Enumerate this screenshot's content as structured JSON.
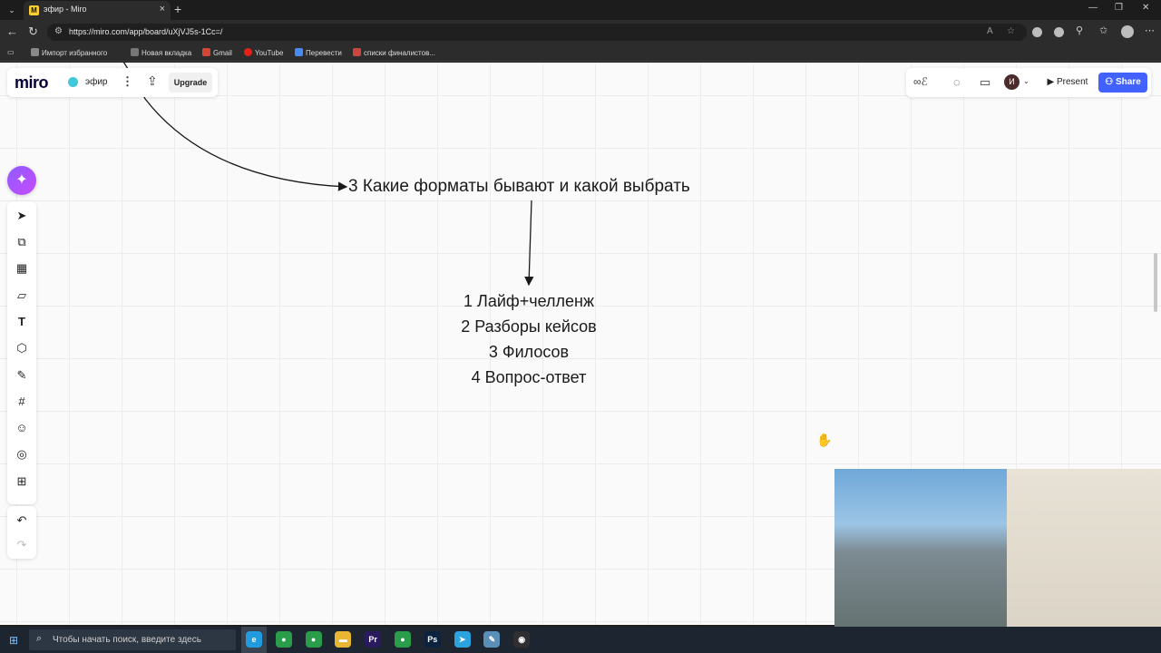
{
  "browser": {
    "tab_title": "эфир - Miro",
    "url": "https://miro.com/app/board/uXjVJ5s-1Cc=/",
    "bookmarks": [
      "Импорт избранного",
      "Новая вкладка",
      "Gmail",
      "YouTube",
      "Перевести",
      "списки финалистов..."
    ]
  },
  "miro": {
    "logo": "miro",
    "board_name": "эфир",
    "upgrade_label": "Upgrade",
    "present_label": "Present",
    "share_label": "Share",
    "avatar_initial": "И"
  },
  "board": {
    "heading": "3 Какие форматы бывают и какой выбрать",
    "list": [
      "1 Лайф+челленж",
      "2 Разборы кейсов",
      "3 Филосов",
      "4 Вопрос-ответ"
    ]
  },
  "taskbar": {
    "search_placeholder": "Чтобы начать поиск, введите здесь",
    "apps": [
      {
        "name": "edge",
        "label": "e",
        "color": "#1f9bde"
      },
      {
        "name": "chrome",
        "label": "●",
        "color": "#2a9d4b"
      },
      {
        "name": "chrome-2",
        "label": "●",
        "color": "#2a9d4b"
      },
      {
        "name": "file-explorer",
        "label": "▬",
        "color": "#e8b632"
      },
      {
        "name": "premiere",
        "label": "Pr",
        "color": "#2a1a5e"
      },
      {
        "name": "chrome-3",
        "label": "●",
        "color": "#2a9d4b"
      },
      {
        "name": "photoshop",
        "label": "Ps",
        "color": "#0c2340"
      },
      {
        "name": "telegram",
        "label": "➤",
        "color": "#2aa3df"
      },
      {
        "name": "notepad",
        "label": "✎",
        "color": "#5a8fb8"
      },
      {
        "name": "obs",
        "label": "◉",
        "color": "#302e31"
      }
    ]
  }
}
